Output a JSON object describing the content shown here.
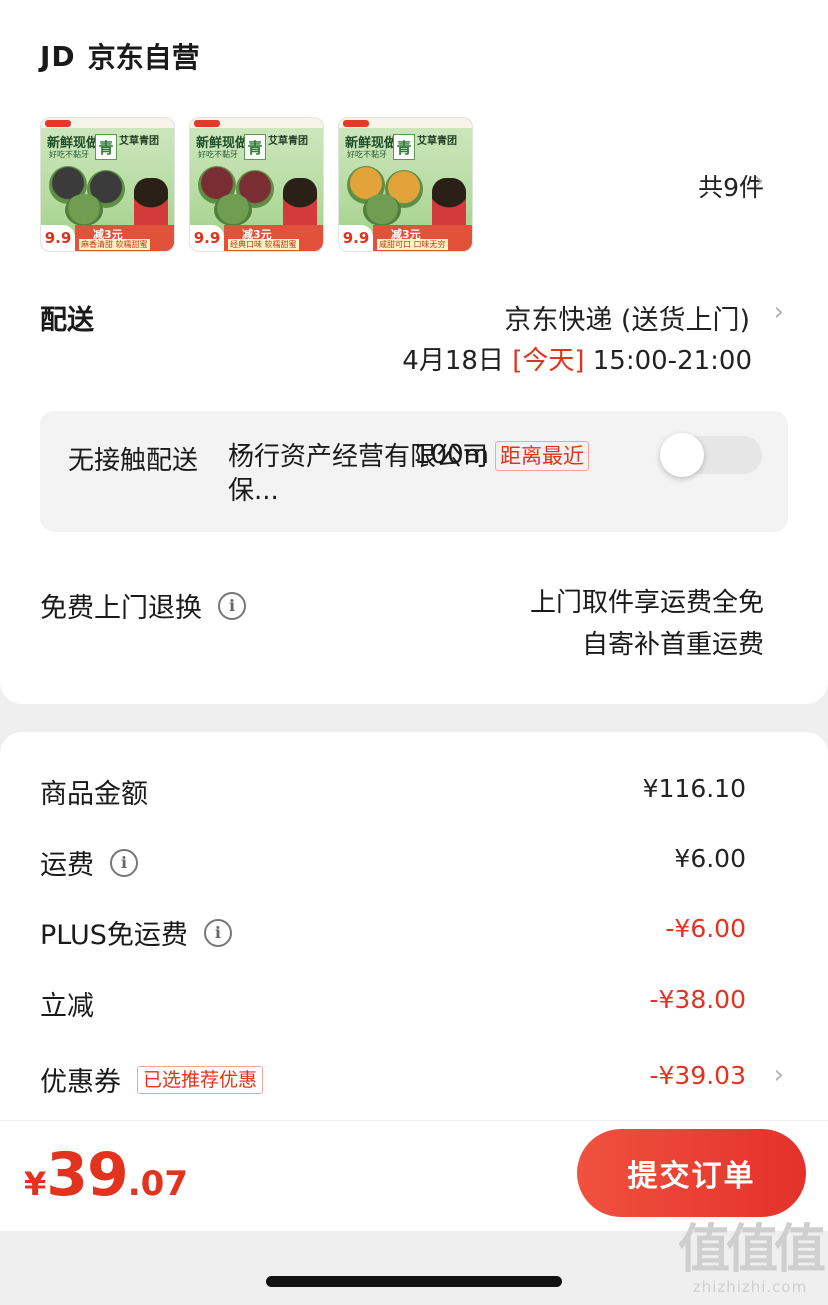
{
  "store": {
    "prefix": "JD",
    "name": "京东自营"
  },
  "products": [
    {
      "fresh": "新鲜现做",
      "slogan": "好吃不黏牙",
      "qing": "青",
      "brand": "艾草青团",
      "price": "9.9",
      "promo": "减3元",
      "flavor": "麻香清甜 软糯甜蜜",
      "filling_color": "#3b3b3b"
    },
    {
      "fresh": "新鲜现做",
      "slogan": "好吃不黏牙",
      "qing": "青",
      "brand": "艾草青团",
      "price": "9.9",
      "promo": "减3元",
      "flavor": "经典口味 软糯甜蜜",
      "filling_color": "#7a2d33"
    },
    {
      "fresh": "新鲜现做",
      "slogan": "好吃不黏牙",
      "qing": "青",
      "brand": "艾草青团",
      "price": "9.9",
      "promo": "减3元",
      "flavor": "咸甜可口 口味无穷",
      "filling_color": "#e2a43a"
    }
  ],
  "item_count": "共9件",
  "delivery": {
    "label": "配送",
    "method": "京东快递 (送货上门)",
    "date": "4月18日",
    "today": "[今天]",
    "window": "15:00-21:00"
  },
  "no_contact": {
    "label": "无接触配送",
    "place": "杨行资产经营有限公司保...",
    "distance": "100m",
    "tag": "距离最近",
    "enabled": false
  },
  "returns": {
    "label": "免费上门退换",
    "line1": "上门取件享运费全免",
    "line2": "自寄补首重运费"
  },
  "summary": {
    "goods": {
      "label": "商品金额",
      "value": "¥116.10"
    },
    "shipping": {
      "label": "运费",
      "value": "¥6.00"
    },
    "plus": {
      "label": "PLUS免运费",
      "value": "-¥6.00"
    },
    "discount": {
      "label": "立减",
      "value": "-¥38.00"
    },
    "coupon": {
      "label": "优惠券",
      "tag": "已选推荐优惠",
      "value": "-¥39.03"
    }
  },
  "total": {
    "currency": "¥",
    "integer": "39",
    "decimal": ".07"
  },
  "submit_label": "提交订单",
  "watermark": {
    "glyphs": "值值值",
    "site": "zhizhizhi.com"
  },
  "colors": {
    "accent": "#e2331e",
    "button": "#e8392c"
  }
}
